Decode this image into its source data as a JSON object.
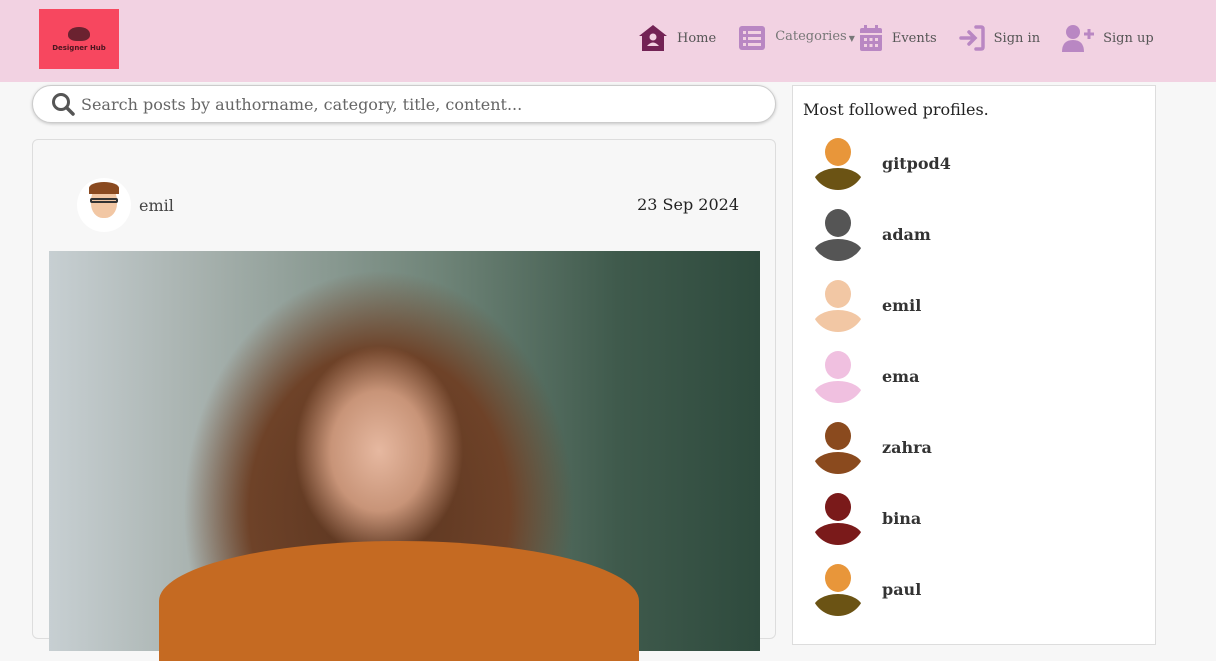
{
  "brand": {
    "name": "Designer Hub"
  },
  "nav": {
    "items": [
      {
        "label": "Home",
        "icon": "home-icon"
      },
      {
        "label": "Categories",
        "icon": "list-icon"
      },
      {
        "label": "Events",
        "icon": "calendar-icon"
      },
      {
        "label": "Sign in",
        "icon": "sign-in-icon"
      },
      {
        "label": "Sign up",
        "icon": "user-plus-icon"
      }
    ]
  },
  "search": {
    "placeholder": "Search posts by authorname, category, title, content..."
  },
  "post": {
    "author": "emil",
    "date": "23 Sep 2024"
  },
  "sidebar": {
    "title": "Most followed profiles.",
    "profiles": [
      {
        "name": "gitpod4",
        "avatar_color": "#e8963a"
      },
      {
        "name": "adam",
        "avatar_color": "#555"
      },
      {
        "name": "emil",
        "avatar_color": "#f2c7a4"
      },
      {
        "name": "ema",
        "avatar_color": "#f0c0e0"
      },
      {
        "name": "zahra",
        "avatar_color": "#8a4a1e"
      },
      {
        "name": "bina",
        "avatar_color": "#7a1a1a"
      },
      {
        "name": "paul",
        "avatar_color": "#e8963a"
      }
    ]
  },
  "colors": {
    "nav_bg": "#f2d2e2",
    "home_icon": "#732355",
    "icon": "#b987c3"
  }
}
